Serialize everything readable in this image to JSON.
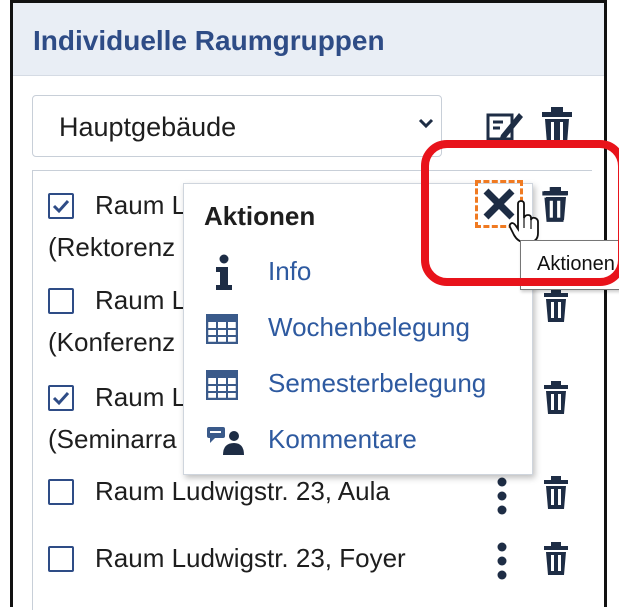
{
  "panel": {
    "title": "Individuelle Raumgruppen"
  },
  "group_select": {
    "value": "Hauptgebäude"
  },
  "group_actions": {
    "edit_icon": "edit-icon",
    "delete_icon": "trash-icon"
  },
  "rooms": [
    {
      "line1": "Raum L",
      "line2": "(Rektorenz",
      "checked": true
    },
    {
      "line1": "Raum L",
      "line2": "(Konferenz",
      "checked": false
    },
    {
      "line1": "Raum L",
      "line2": "(Seminarra",
      "checked": true
    },
    {
      "line1": "Raum Ludwigstr. 23, Aula",
      "checked": false
    },
    {
      "line1": "Raum Ludwigstr. 23, Foyer",
      "checked": false
    }
  ],
  "actions_menu": {
    "title": "Aktionen",
    "items": [
      {
        "label": "Info",
        "icon": "info-icon"
      },
      {
        "label": "Wochenbelegung",
        "icon": "calendar-icon"
      },
      {
        "label": "Semesterbelegung",
        "icon": "calendar-icon"
      },
      {
        "label": "Kommentare",
        "icon": "comments-icon"
      }
    ]
  },
  "tooltip": {
    "text": "Aktionen"
  },
  "colors": {
    "accent": "#2e4c86",
    "link": "#2e5aa0",
    "focus": "#f07a21",
    "highlight": "#e8131b"
  }
}
